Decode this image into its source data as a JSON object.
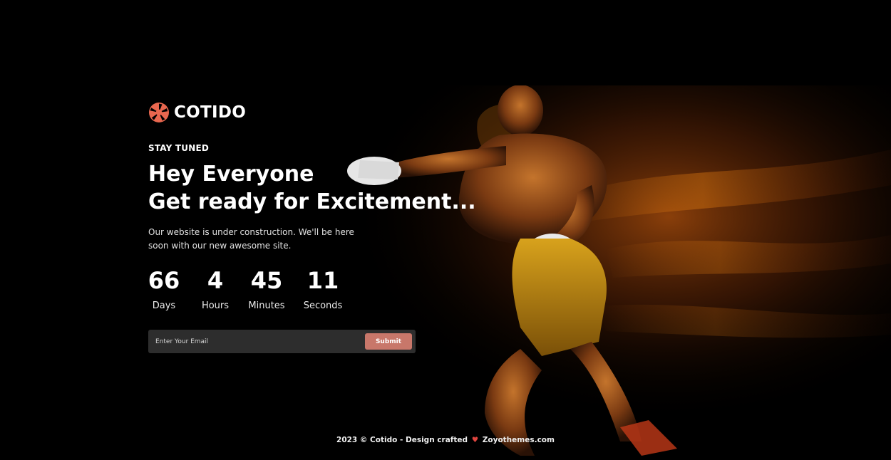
{
  "brand": {
    "name": "COTIDO",
    "logo_icon": "aperture-icon",
    "accent": "#e9674f"
  },
  "hero": {
    "tagline": "STAY TUNED",
    "headline_line1": "Hey Everyone",
    "headline_line2": "Get ready for Excitement...",
    "description": "Our website is under construction. We'll be here soon with our new awesome site."
  },
  "countdown": [
    {
      "value": "66",
      "label": "Days"
    },
    {
      "value": "4",
      "label": "Hours"
    },
    {
      "value": "45",
      "label": "Minutes"
    },
    {
      "value": "11",
      "label": "Seconds"
    }
  ],
  "subscribe": {
    "placeholder": "Enter Your Email",
    "button_label": "Submit",
    "button_color": "#c8776a"
  },
  "footer": {
    "text_before": "2023 © Cotido - Design crafted",
    "heart_icon": "heart-icon",
    "text_after": "Zoyothemes.com"
  }
}
